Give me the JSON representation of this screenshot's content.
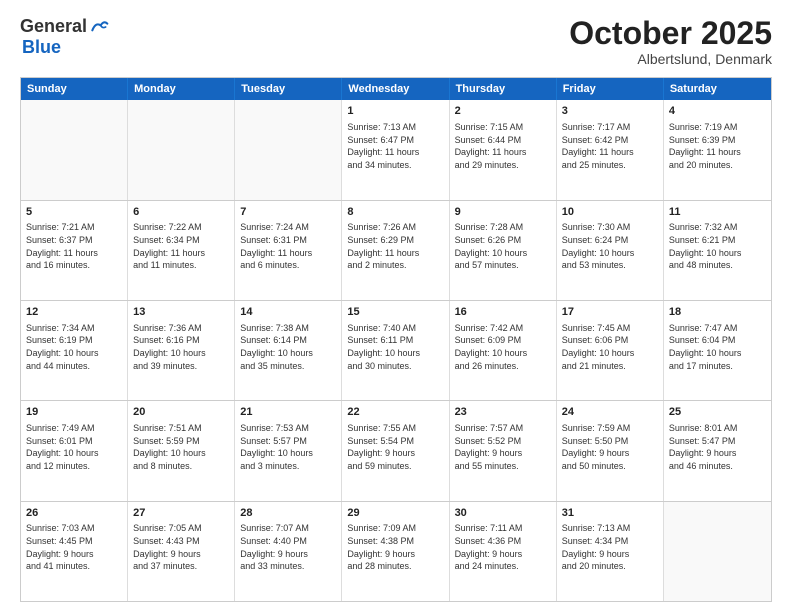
{
  "header": {
    "logo_general": "General",
    "logo_blue": "Blue",
    "month_title": "October 2025",
    "location": "Albertslund, Denmark"
  },
  "weekdays": [
    "Sunday",
    "Monday",
    "Tuesday",
    "Wednesday",
    "Thursday",
    "Friday",
    "Saturday"
  ],
  "rows": [
    [
      {
        "day": "",
        "info": ""
      },
      {
        "day": "",
        "info": ""
      },
      {
        "day": "",
        "info": ""
      },
      {
        "day": "1",
        "info": "Sunrise: 7:13 AM\nSunset: 6:47 PM\nDaylight: 11 hours\nand 34 minutes."
      },
      {
        "day": "2",
        "info": "Sunrise: 7:15 AM\nSunset: 6:44 PM\nDaylight: 11 hours\nand 29 minutes."
      },
      {
        "day": "3",
        "info": "Sunrise: 7:17 AM\nSunset: 6:42 PM\nDaylight: 11 hours\nand 25 minutes."
      },
      {
        "day": "4",
        "info": "Sunrise: 7:19 AM\nSunset: 6:39 PM\nDaylight: 11 hours\nand 20 minutes."
      }
    ],
    [
      {
        "day": "5",
        "info": "Sunrise: 7:21 AM\nSunset: 6:37 PM\nDaylight: 11 hours\nand 16 minutes."
      },
      {
        "day": "6",
        "info": "Sunrise: 7:22 AM\nSunset: 6:34 PM\nDaylight: 11 hours\nand 11 minutes."
      },
      {
        "day": "7",
        "info": "Sunrise: 7:24 AM\nSunset: 6:31 PM\nDaylight: 11 hours\nand 6 minutes."
      },
      {
        "day": "8",
        "info": "Sunrise: 7:26 AM\nSunset: 6:29 PM\nDaylight: 11 hours\nand 2 minutes."
      },
      {
        "day": "9",
        "info": "Sunrise: 7:28 AM\nSunset: 6:26 PM\nDaylight: 10 hours\nand 57 minutes."
      },
      {
        "day": "10",
        "info": "Sunrise: 7:30 AM\nSunset: 6:24 PM\nDaylight: 10 hours\nand 53 minutes."
      },
      {
        "day": "11",
        "info": "Sunrise: 7:32 AM\nSunset: 6:21 PM\nDaylight: 10 hours\nand 48 minutes."
      }
    ],
    [
      {
        "day": "12",
        "info": "Sunrise: 7:34 AM\nSunset: 6:19 PM\nDaylight: 10 hours\nand 44 minutes."
      },
      {
        "day": "13",
        "info": "Sunrise: 7:36 AM\nSunset: 6:16 PM\nDaylight: 10 hours\nand 39 minutes."
      },
      {
        "day": "14",
        "info": "Sunrise: 7:38 AM\nSunset: 6:14 PM\nDaylight: 10 hours\nand 35 minutes."
      },
      {
        "day": "15",
        "info": "Sunrise: 7:40 AM\nSunset: 6:11 PM\nDaylight: 10 hours\nand 30 minutes."
      },
      {
        "day": "16",
        "info": "Sunrise: 7:42 AM\nSunset: 6:09 PM\nDaylight: 10 hours\nand 26 minutes."
      },
      {
        "day": "17",
        "info": "Sunrise: 7:45 AM\nSunset: 6:06 PM\nDaylight: 10 hours\nand 21 minutes."
      },
      {
        "day": "18",
        "info": "Sunrise: 7:47 AM\nSunset: 6:04 PM\nDaylight: 10 hours\nand 17 minutes."
      }
    ],
    [
      {
        "day": "19",
        "info": "Sunrise: 7:49 AM\nSunset: 6:01 PM\nDaylight: 10 hours\nand 12 minutes."
      },
      {
        "day": "20",
        "info": "Sunrise: 7:51 AM\nSunset: 5:59 PM\nDaylight: 10 hours\nand 8 minutes."
      },
      {
        "day": "21",
        "info": "Sunrise: 7:53 AM\nSunset: 5:57 PM\nDaylight: 10 hours\nand 3 minutes."
      },
      {
        "day": "22",
        "info": "Sunrise: 7:55 AM\nSunset: 5:54 PM\nDaylight: 9 hours\nand 59 minutes."
      },
      {
        "day": "23",
        "info": "Sunrise: 7:57 AM\nSunset: 5:52 PM\nDaylight: 9 hours\nand 55 minutes."
      },
      {
        "day": "24",
        "info": "Sunrise: 7:59 AM\nSunset: 5:50 PM\nDaylight: 9 hours\nand 50 minutes."
      },
      {
        "day": "25",
        "info": "Sunrise: 8:01 AM\nSunset: 5:47 PM\nDaylight: 9 hours\nand 46 minutes."
      }
    ],
    [
      {
        "day": "26",
        "info": "Sunrise: 7:03 AM\nSunset: 4:45 PM\nDaylight: 9 hours\nand 41 minutes."
      },
      {
        "day": "27",
        "info": "Sunrise: 7:05 AM\nSunset: 4:43 PM\nDaylight: 9 hours\nand 37 minutes."
      },
      {
        "day": "28",
        "info": "Sunrise: 7:07 AM\nSunset: 4:40 PM\nDaylight: 9 hours\nand 33 minutes."
      },
      {
        "day": "29",
        "info": "Sunrise: 7:09 AM\nSunset: 4:38 PM\nDaylight: 9 hours\nand 28 minutes."
      },
      {
        "day": "30",
        "info": "Sunrise: 7:11 AM\nSunset: 4:36 PM\nDaylight: 9 hours\nand 24 minutes."
      },
      {
        "day": "31",
        "info": "Sunrise: 7:13 AM\nSunset: 4:34 PM\nDaylight: 9 hours\nand 20 minutes."
      },
      {
        "day": "",
        "info": ""
      }
    ]
  ]
}
